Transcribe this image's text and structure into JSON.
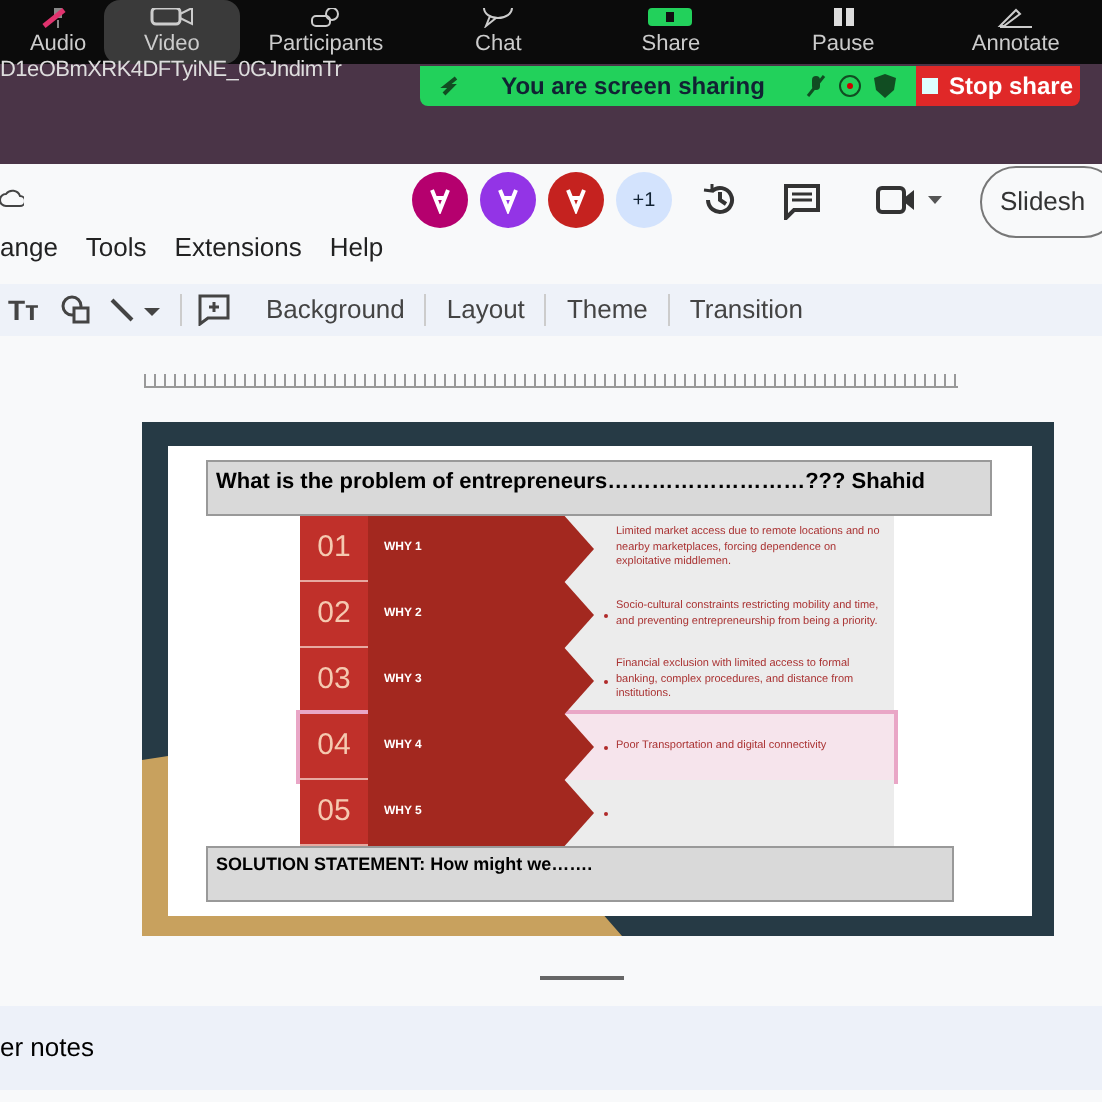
{
  "zoom_toolbar": {
    "items": [
      {
        "kind": "audio",
        "label": "Audio",
        "selected": false
      },
      {
        "kind": "video",
        "label": "Video",
        "selected": true
      },
      {
        "kind": "participants",
        "label": "Participants",
        "selected": false
      },
      {
        "kind": "chat",
        "label": "Chat",
        "selected": false
      },
      {
        "kind": "share",
        "label": "Share",
        "selected": false
      },
      {
        "kind": "pause",
        "label": "Pause",
        "selected": false
      },
      {
        "kind": "annotate",
        "label": "Annotate",
        "selected": false
      }
    ]
  },
  "url_fragment": "D1eOBmXRK4DFTyiNE_0GJndimTr",
  "share_banner": {
    "message": "You are screen sharing",
    "stop_label": "Stop share"
  },
  "slides_app": {
    "menu": [
      "ange",
      "Tools",
      "Extensions",
      "Help"
    ],
    "collaborators": [
      {
        "color": "#b5006e"
      },
      {
        "color": "#9334e6"
      },
      {
        "color": "#c5221f"
      }
    ],
    "more_collaborators": "+1",
    "slideshow_label": "Slidesh",
    "text_style_glyph": "Tт",
    "toolbar_buttons": [
      "Background",
      "Layout",
      "Theme",
      "Transition"
    ]
  },
  "slide": {
    "title": "What is the problem of entrepreneurs………………………??? Shahid",
    "rows": [
      {
        "number": "01",
        "label": "WHY 1",
        "text": "Limited market access due to remote locations and no nearby marketplaces, forcing dependence on exploitative middlemen.",
        "bullet": false,
        "selected": false
      },
      {
        "number": "02",
        "label": "WHY 2",
        "text": "Socio-cultural constraints restricting mobility and time, and preventing entrepreneurship from being a priority.",
        "bullet": true,
        "selected": false
      },
      {
        "number": "03",
        "label": "WHY 3",
        "text": "Financial exclusion with limited access to formal banking, complex procedures, and distance from institutions.",
        "bullet": true,
        "selected": false
      },
      {
        "number": "04",
        "label": "WHY 4",
        "text": "Poor Transportation and digital connectivity",
        "bullet": true,
        "selected": true
      },
      {
        "number": "05",
        "label": "WHY 5",
        "text": "",
        "bullet": true,
        "selected": false
      }
    ],
    "solution": "SOLUTION STATEMENT: How might we……."
  },
  "speaker_notes": "er notes"
}
